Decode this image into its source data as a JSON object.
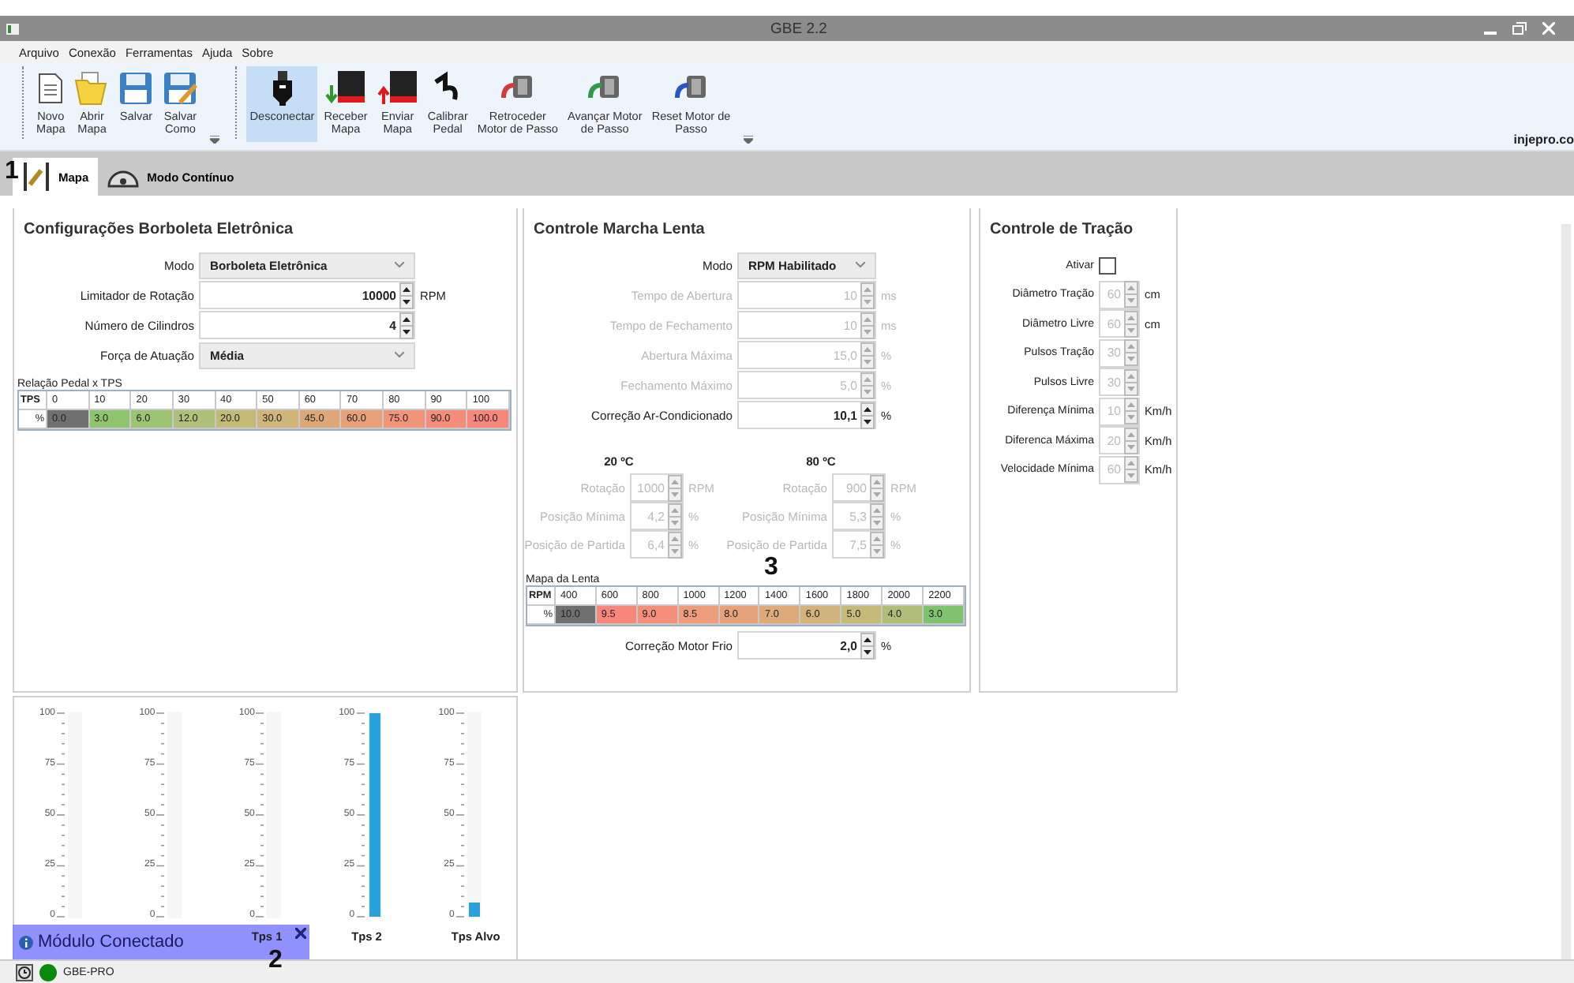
{
  "window": {
    "title": "GBE 2.2"
  },
  "menu": [
    "Arquivo",
    "Conexão",
    "Ferramentas",
    "Ajuda",
    "Sobre"
  ],
  "toolbar": {
    "groups": [
      {
        "buttons": [
          {
            "kind": "document",
            "lines": [
              "Novo",
              "Mapa"
            ],
            "selected": false
          },
          {
            "kind": "folder",
            "lines": [
              "Abrir",
              "Mapa"
            ],
            "selected": false
          },
          {
            "kind": "floppy",
            "lines": [
              "Salvar"
            ],
            "selected": false
          },
          {
            "kind": "floppy-pen",
            "lines": [
              "Salvar",
              "Como"
            ],
            "selected": false
          }
        ]
      },
      {
        "buttons": [
          {
            "kind": "usb",
            "lines": [
              "Desconectar"
            ],
            "selected": true
          },
          {
            "kind": "chip-down",
            "lines": [
              "Receber",
              "Mapa"
            ],
            "selected": false
          },
          {
            "kind": "chip-up",
            "lines": [
              "Enviar",
              "Mapa"
            ],
            "selected": false
          },
          {
            "kind": "hook",
            "lines": [
              "Calibrar",
              "Pedal"
            ],
            "selected": false
          },
          {
            "kind": "motor-red",
            "lines": [
              "Retroceder",
              "Motor de Passo"
            ],
            "selected": false
          },
          {
            "kind": "motor-green",
            "lines": [
              "Avançar Motor",
              "de Passo"
            ],
            "selected": false
          },
          {
            "kind": "motor-blue",
            "lines": [
              "Reset Motor de",
              "Passo"
            ],
            "selected": false
          }
        ]
      }
    ]
  },
  "brand": "injepro.co",
  "tabs": [
    {
      "label": "Mapa",
      "kind": "pen",
      "selected": true
    },
    {
      "label": "Modo Contínuo",
      "kind": "gauge",
      "selected": false
    }
  ],
  "borboleta": {
    "title": "Configurações Borboleta Eletrônica",
    "rows": [
      {
        "kind": "select",
        "label": "Modo",
        "value": "Borboleta Eletrônica"
      },
      {
        "kind": "spin",
        "label": "Limitador de Rotação",
        "value": "10000",
        "unit": "RPM"
      },
      {
        "kind": "spin",
        "label": "Número de Cilindros",
        "value": "4"
      },
      {
        "kind": "select",
        "label": "Força de Atuação",
        "value": "Média"
      }
    ],
    "table": {
      "caption": "Relação Pedal x TPS",
      "row_header": "TPS",
      "value_header": "%",
      "columns": [
        {
          "head": "0",
          "value": "0.0",
          "color": "#707070"
        },
        {
          "head": "10",
          "value": "3.0",
          "color": "#8fc46f"
        },
        {
          "head": "20",
          "value": "6.0",
          "color": "#9dc474"
        },
        {
          "head": "30",
          "value": "12.0",
          "color": "#afc07a"
        },
        {
          "head": "40",
          "value": "20.0",
          "color": "#c2bb78"
        },
        {
          "head": "50",
          "value": "30.0",
          "color": "#cfb57a"
        },
        {
          "head": "60",
          "value": "45.0",
          "color": "#dca878"
        },
        {
          "head": "70",
          "value": "60.0",
          "color": "#e8a07a"
        },
        {
          "head": "80",
          "value": "75.0",
          "color": "#f0957a"
        },
        {
          "head": "90",
          "value": "90.0",
          "color": "#f48e7a"
        },
        {
          "head": "100",
          "value": "100.0",
          "color": "#f7877a"
        }
      ]
    }
  },
  "lenta": {
    "title": "Controle Marcha Lenta",
    "rows": [
      {
        "kind": "select",
        "label": "Modo",
        "value": "RPM Habilitado"
      },
      {
        "kind": "spin",
        "label": "Tempo de Abertura",
        "value": "10",
        "unit": "ms",
        "disabled": true
      },
      {
        "kind": "spin",
        "label": "Tempo de Fechamento",
        "value": "10",
        "unit": "ms",
        "disabled": true
      },
      {
        "kind": "spin",
        "label": "Abertura Máxima",
        "value": "15,0",
        "unit": "%",
        "disabled": true
      },
      {
        "kind": "spin",
        "label": "Fechamento Máximo",
        "value": "5,0",
        "unit": "%",
        "disabled": true
      },
      {
        "kind": "spin",
        "label": "Correção Ar-Condicionado",
        "value": "10,1",
        "unit": "%",
        "disabled": false
      }
    ],
    "temps": [
      {
        "title": "20 ºC",
        "rows": [
          {
            "label": "Rotação",
            "value": "1000",
            "unit": "RPM",
            "disabled": true
          },
          {
            "label": "Posição Mínima",
            "value": "4,2",
            "unit": "%",
            "disabled": true
          },
          {
            "label": "Posição de Partida",
            "value": "6,4",
            "unit": "%",
            "disabled": true
          }
        ]
      },
      {
        "title": "80 ºC",
        "rows": [
          {
            "label": "Rotação",
            "value": "900",
            "unit": "RPM",
            "disabled": true
          },
          {
            "label": "Posição Mínima",
            "value": "5,3",
            "unit": "%",
            "disabled": true
          },
          {
            "label": "Posição de Partida",
            "value": "7,5",
            "unit": "%",
            "disabled": true
          }
        ]
      }
    ],
    "table": {
      "caption": "Mapa da Lenta",
      "row_header": "RPM",
      "value_header": "%",
      "columns": [
        {
          "head": "400",
          "value": "10.0",
          "color": "#707070"
        },
        {
          "head": "600",
          "value": "9.5",
          "color": "#f7877a"
        },
        {
          "head": "800",
          "value": "9.0",
          "color": "#f4907a"
        },
        {
          "head": "1000",
          "value": "8.5",
          "color": "#ee9c7b"
        },
        {
          "head": "1200",
          "value": "8.0",
          "color": "#e8a27a"
        },
        {
          "head": "1400",
          "value": "7.0",
          "color": "#deaa7a"
        },
        {
          "head": "1600",
          "value": "6.0",
          "color": "#d2b37a"
        },
        {
          "head": "1800",
          "value": "5.0",
          "color": "#c6ba78"
        },
        {
          "head": "2000",
          "value": "4.0",
          "color": "#b0bf78"
        },
        {
          "head": "2200",
          "value": "3.0",
          "color": "#7fc36e"
        }
      ]
    },
    "cold": {
      "label": "Correção Motor Frio",
      "value": "2,0",
      "unit": "%",
      "disabled": false
    }
  },
  "tracao": {
    "title": "Controle de Tração",
    "enable": {
      "label": "Ativar",
      "checked": false
    },
    "rows": [
      {
        "label": "Diâmetro Tração",
        "value": "60",
        "unit": "cm",
        "disabled": true
      },
      {
        "label": "Diâmetro Livre",
        "value": "60",
        "unit": "cm",
        "disabled": true
      },
      {
        "label": "Pulsos Tração",
        "value": "30",
        "disabled": true
      },
      {
        "label": "Pulsos Livre",
        "value": "30",
        "disabled": true
      },
      {
        "label": "Diferença Mínima",
        "value": "10",
        "unit": "Km/h",
        "disabled": true
      },
      {
        "label": "Diferenca Máxima",
        "value": "20",
        "unit": "Km/h",
        "disabled": true
      },
      {
        "label": "Velocidade Mínima",
        "value": "60",
        "unit": "Km/h",
        "disabled": true
      }
    ]
  },
  "gauges": [
    {
      "ticks": [
        "100",
        "75",
        "50",
        "25",
        "0"
      ],
      "level": 0
    },
    {
      "ticks": [
        "100",
        "75",
        "50",
        "25",
        "0"
      ],
      "level": 0
    },
    {
      "ticks": [
        "100",
        "75",
        "50",
        "25",
        "0"
      ],
      "level": 0,
      "label": "Tps 1"
    },
    {
      "ticks": [
        "100",
        "75",
        "50",
        "25",
        "0"
      ],
      "level": 1,
      "label": "Tps 2"
    },
    {
      "ticks": [
        "100",
        "75",
        "50",
        "25",
        "0"
      ],
      "level": 0.07,
      "label": "Tps Alvo"
    }
  ],
  "notification": {
    "text": "Módulo Conectado"
  },
  "status": {
    "text": "GBE-PRO",
    "connected": true
  },
  "callouts": [
    "1",
    "2",
    "3"
  ]
}
